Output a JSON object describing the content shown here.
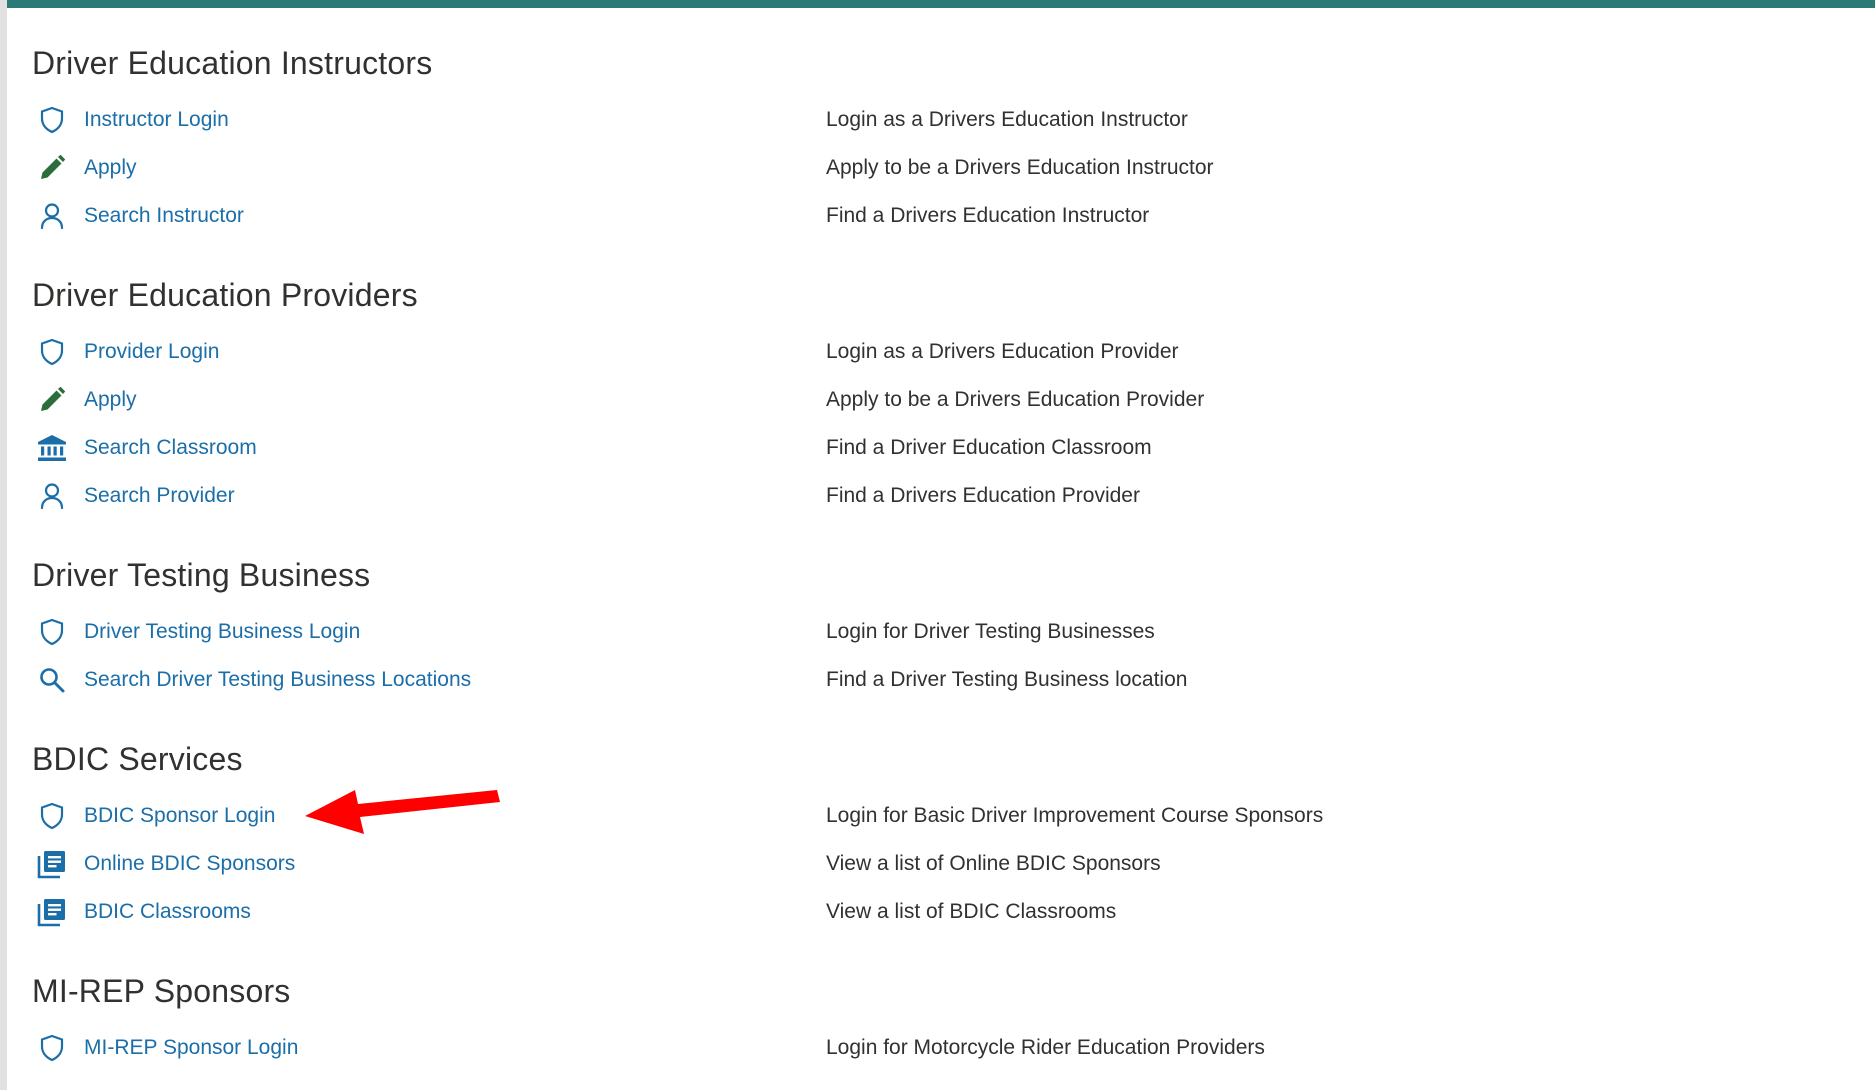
{
  "sections": [
    {
      "title": "Driver Education Instructors",
      "items": [
        {
          "icon": "shield-icon",
          "label": "Instructor Login",
          "description": "Login as a Drivers Education Instructor"
        },
        {
          "icon": "pencil-icon",
          "label": "Apply",
          "description": "Apply to be a Drivers Education Instructor"
        },
        {
          "icon": "person-icon",
          "label": "Search Instructor",
          "description": "Find a Drivers Education Instructor"
        }
      ]
    },
    {
      "title": "Driver Education Providers",
      "items": [
        {
          "icon": "shield-icon",
          "label": "Provider Login",
          "description": "Login as a Drivers Education Provider"
        },
        {
          "icon": "pencil-icon",
          "label": "Apply",
          "description": "Apply to be a Drivers Education Provider"
        },
        {
          "icon": "bank-icon",
          "label": "Search Classroom",
          "description": "Find a Driver Education Classroom"
        },
        {
          "icon": "person-icon",
          "label": "Search Provider",
          "description": "Find a Drivers Education Provider"
        }
      ]
    },
    {
      "title": "Driver Testing Business",
      "items": [
        {
          "icon": "shield-icon",
          "label": "Driver Testing Business Login",
          "description": "Login for Driver Testing Businesses"
        },
        {
          "icon": "search-icon",
          "label": "Search Driver Testing Business Locations",
          "description": "Find a Driver Testing Business location"
        }
      ]
    },
    {
      "title": "BDIC Services",
      "items": [
        {
          "icon": "shield-icon",
          "label": "BDIC Sponsor Login",
          "description": "Login for Basic Driver Improvement Course Sponsors"
        },
        {
          "icon": "library-icon",
          "label": "Online BDIC Sponsors",
          "description": "View a list of Online BDIC Sponsors"
        },
        {
          "icon": "library-icon",
          "label": "BDIC Classrooms",
          "description": "View a list of BDIC Classrooms"
        }
      ]
    },
    {
      "title": "MI-REP Sponsors",
      "items": [
        {
          "icon": "shield-icon",
          "label": "MI-REP Sponsor Login",
          "description": "Login for Motorcycle Rider Education Providers"
        }
      ]
    }
  ],
  "colors": {
    "link": "#1b6ea8",
    "icon": "#1b6ea8",
    "pencil_icon": "#2b6d3c",
    "annotation_arrow": "#ff0000"
  },
  "annotation": {
    "type": "arrow",
    "target": "BDIC Sponsor Login"
  }
}
